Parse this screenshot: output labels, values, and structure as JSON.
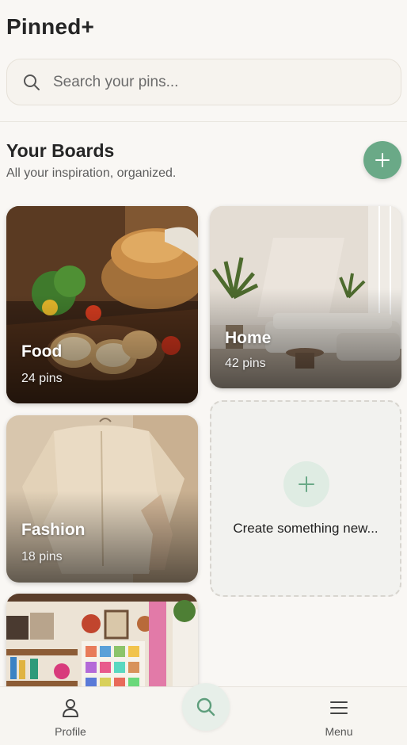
{
  "app": {
    "title": "Pinned+"
  },
  "search": {
    "placeholder": "Search your pins..."
  },
  "boards_section": {
    "title": "Your Boards",
    "subtitle": "All your inspiration, organized."
  },
  "boards": [
    {
      "name": "Food",
      "count": "24 pins"
    },
    {
      "name": "Home",
      "count": "42 pins"
    },
    {
      "name": "Fashion",
      "count": "18 pins"
    }
  ],
  "create_card": {
    "label": "Create something new..."
  },
  "bottom_nav": {
    "profile_label": "Profile",
    "menu_label": "Menu"
  },
  "colors": {
    "accent": "#6aa987",
    "accent_light": "#dfece3",
    "background": "#f9f7f4"
  },
  "icons": {
    "search": "search-icon",
    "add": "plus-icon",
    "profile": "person-icon",
    "menu": "hamburger-icon"
  }
}
